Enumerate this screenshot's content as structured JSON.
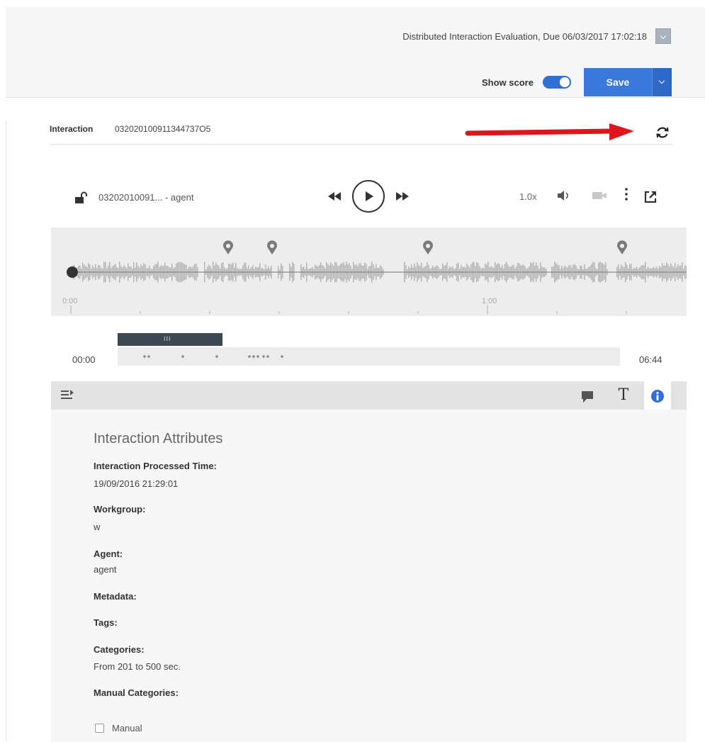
{
  "header": {
    "evaluation_title": "Distributed Interaction Evaluation, Due 06/03/2017 17:02:18",
    "show_score_label": "Show score",
    "show_score_on": true,
    "save_label": "Save"
  },
  "interaction": {
    "label": "Interaction",
    "id": "032020100911344737O5"
  },
  "player": {
    "media_name": "03202010091...  -  agent",
    "speed": "1.0x",
    "waveform_time_start": "0:00",
    "waveform_time_mid": "1:00",
    "timeline_start": "00:00",
    "timeline_end": "06:44",
    "selection_grip": "III"
  },
  "panel": {
    "title": "Interaction Attributes",
    "attributes": [
      {
        "label": "Interaction Processed Time:",
        "value": "19/09/2016 21:29:01"
      },
      {
        "label": "Workgroup:",
        "value": "w"
      },
      {
        "label": "Agent:",
        "value": "agent"
      },
      {
        "label": "Metadata:",
        "value": ""
      },
      {
        "label": "Tags:",
        "value": ""
      },
      {
        "label": "Categories:",
        "value": "From 201 to 500 sec."
      },
      {
        "label": "Manual Categories:",
        "value": ""
      }
    ],
    "manual_checkbox_label": "Manual",
    "manual_checked": false
  },
  "colors": {
    "accent": "#3b78db",
    "annotation_arrow": "#e0151b"
  },
  "icons": [
    "lock-open-icon",
    "rewind-icon",
    "play-icon",
    "fast-forward-icon",
    "volume-icon",
    "video-icon",
    "more-vertical-icon",
    "popout-icon",
    "refresh-icon",
    "outline-icon",
    "comment-icon",
    "text-icon",
    "info-icon"
  ]
}
